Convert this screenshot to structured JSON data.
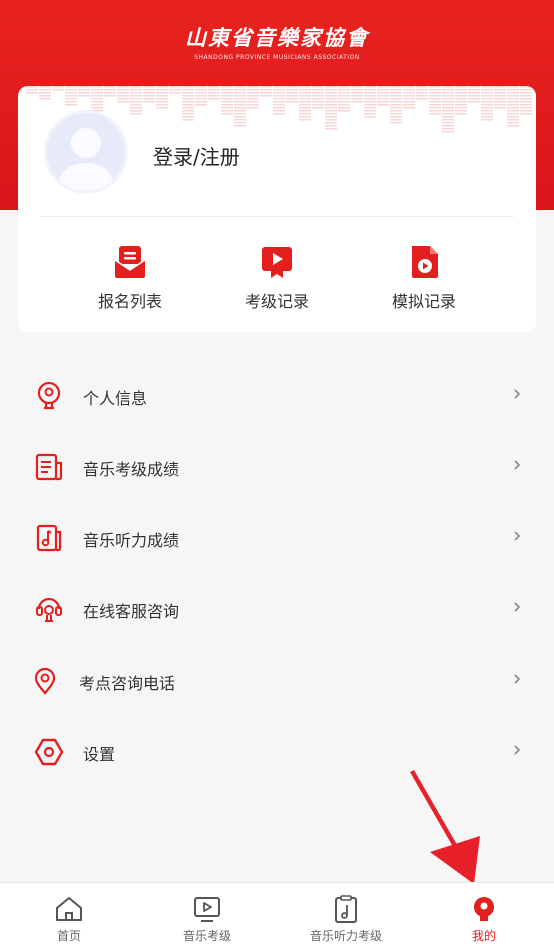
{
  "header": {
    "logo_cn": "山東省音樂家協會",
    "logo_en": "SHANDONG PROVINCE MUSICIANS ASSOCIATION"
  },
  "profile": {
    "login_label": "登录/注册"
  },
  "quick_actions": [
    {
      "label": "报名列表",
      "icon": "envelope-list-icon"
    },
    {
      "label": "考级记录",
      "icon": "video-record-icon"
    },
    {
      "label": "模拟记录",
      "icon": "document-play-icon"
    }
  ],
  "menu": [
    {
      "label": "个人信息",
      "icon": "person-icon"
    },
    {
      "label": "音乐考级成绩",
      "icon": "report-icon"
    },
    {
      "label": "音乐听力成绩",
      "icon": "music-note-book-icon"
    },
    {
      "label": "在线客服咨询",
      "icon": "headset-icon"
    },
    {
      "label": "考点咨询电话",
      "icon": "location-pin-icon"
    },
    {
      "label": "设置",
      "icon": "settings-hexagon-icon"
    }
  ],
  "tabbar": [
    {
      "label": "首页",
      "icon": "home-icon",
      "active": false
    },
    {
      "label": "音乐考级",
      "icon": "video-play-icon",
      "active": false
    },
    {
      "label": "音乐听力考级",
      "icon": "music-clipboard-icon",
      "active": false
    },
    {
      "label": "我的",
      "icon": "profile-icon",
      "active": true
    }
  ],
  "colors": {
    "brand_red": "#e3201d",
    "background": "#f6f6f6",
    "text": "#333333"
  }
}
